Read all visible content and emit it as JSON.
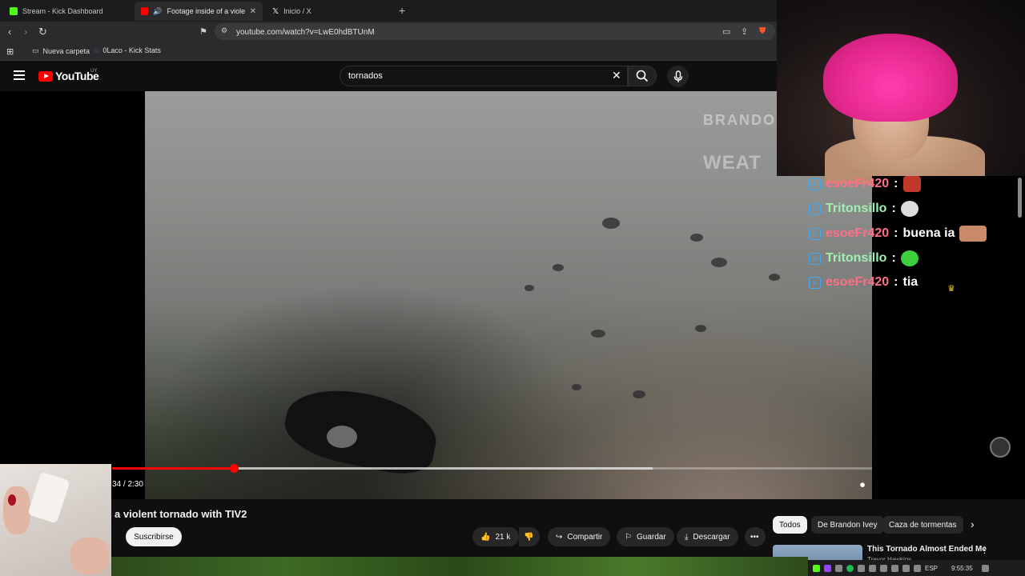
{
  "browser": {
    "tabs": [
      {
        "title": "Stream - Kick Dashboard",
        "icon": "kick-icon",
        "color": "#53fc18"
      },
      {
        "title": "Footage inside of a violent to",
        "icon": "youtube-icon",
        "color": "#ff0000"
      },
      {
        "title": "Inicio / X",
        "icon": "x-icon",
        "color": "#ffffff"
      }
    ],
    "url": "youtube.com/watch?v=LwE0hdBTUnM",
    "bookmarks": [
      {
        "label": "Nueva carpeta",
        "icon": "folder-icon"
      },
      {
        "label": "0Laco - Kick Stats",
        "icon": "link-icon"
      }
    ]
  },
  "youtube": {
    "logo_text": "YouTube",
    "country_code": "UY",
    "search_value": "tornados",
    "watermark_top": "BRANDO",
    "watermark_bottom": "WEAT",
    "progress": 0.16,
    "buffered": 0.71,
    "time": "34 / 2:30",
    "video_title": "a violent tornado with TIV2",
    "subscribe": "Suscribirse",
    "likes": "21 k",
    "share": "Compartir",
    "save": "Guardar",
    "download": "Descargar",
    "chips": [
      "Todos",
      "De Brandon Ivey",
      "Caza de tormentas"
    ],
    "related_title": "This Tornado Almost Ended Me",
    "related_channel": "Trevor Hawkins"
  },
  "chat": [
    {
      "user": "esoeFr420",
      "color": "pink",
      "text": "",
      "emote_color": "#c0392b"
    },
    {
      "user": "Tritonsillo",
      "color": "green",
      "text": "",
      "emote_color": "#dddddd"
    },
    {
      "user": "esoeFr420",
      "color": "pink",
      "text": "buena ia",
      "emote_color": "#c98a6a"
    },
    {
      "user": "Tritonsillo",
      "color": "green",
      "text": "",
      "emote_color": "#3ecf3e"
    },
    {
      "user": "esoeFr420",
      "color": "pink",
      "text": "tia",
      "emote_color": ""
    }
  ],
  "separator": ":",
  "taskbar": {
    "lang": "ESP",
    "clock": "9:55:35"
  }
}
